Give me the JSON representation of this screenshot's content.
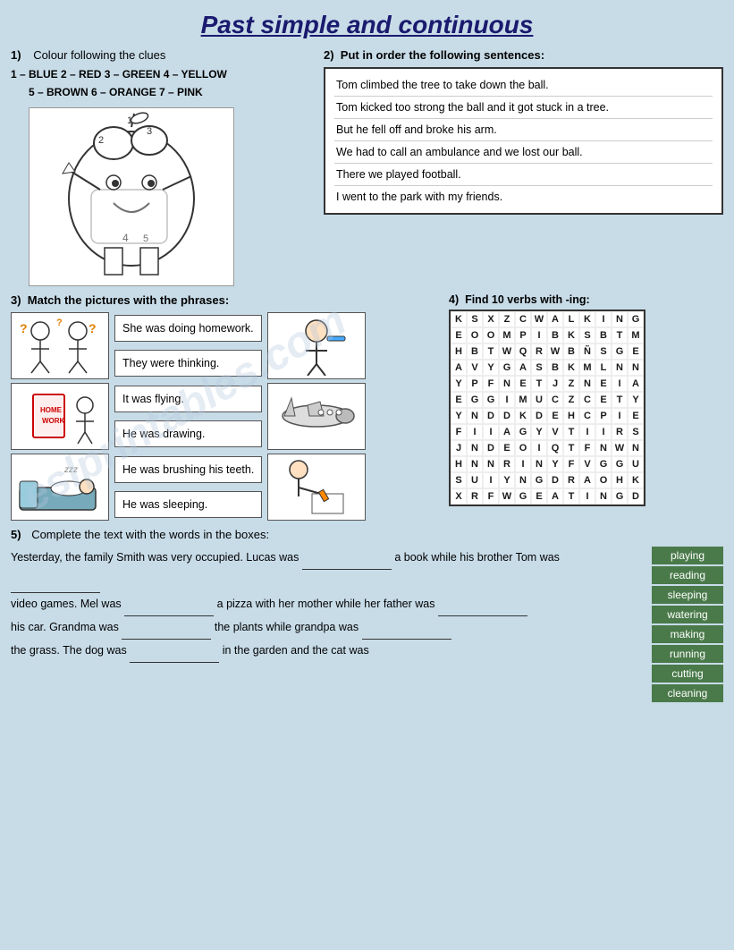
{
  "title": "Past simple and continuous",
  "section1": {
    "label": "1)",
    "instruction": "Colour following the clues",
    "clues_line1": "1 – BLUE   2 – RED   3 – GREEN   4 – YELLOW",
    "clues_line2": "5 – BROWN   6 – ORANGE   7 – PINK"
  },
  "section2": {
    "label": "2)",
    "instruction": "Put in order the following sentences:",
    "sentences": [
      "Tom climbed the tree to take down the ball.",
      "Tom kicked too strong the ball and it got stuck in a tree.",
      "But he fell off and broke his arm.",
      "We had to call an ambulance and we lost our ball.",
      "There we played football.",
      "I went to the park with my friends."
    ]
  },
  "section3": {
    "label": "3)",
    "instruction": "Match the pictures with the phrases:",
    "phrases": [
      "She was doing homework.",
      "They were thinking.",
      "It was flying.",
      "He was drawing.",
      "He was brushing his teeth.",
      "He was sleeping."
    ]
  },
  "section4": {
    "label": "4)",
    "instruction": "Find 10 verbs with -ing:",
    "grid": [
      [
        "K",
        "S",
        "X",
        "Z",
        "C",
        "W",
        "A",
        "L",
        "K",
        "I",
        "N",
        "G"
      ],
      [
        "E",
        "O",
        "O",
        "M",
        "P",
        "I",
        "B",
        "K",
        "S",
        "B",
        "T",
        "M"
      ],
      [
        "H",
        "B",
        "T",
        "W",
        "Q",
        "R",
        "W",
        "B",
        "Ñ",
        "S",
        "G",
        "E"
      ],
      [
        "A",
        "V",
        "Y",
        "G",
        "A",
        "S",
        "B",
        "K",
        "M",
        "L",
        "N",
        "N"
      ],
      [
        "Y",
        "P",
        "F",
        "N",
        "E",
        "T",
        "J",
        "Z",
        "N",
        "E",
        "I",
        "A"
      ],
      [
        "E",
        "G",
        "G",
        "I",
        "M",
        "U",
        "C",
        "Z",
        "C",
        "E",
        "T",
        "Y"
      ],
      [
        "Y",
        "N",
        "D",
        "D",
        "K",
        "D",
        "E",
        "H",
        "C",
        "P",
        "I",
        "E"
      ],
      [
        "F",
        "I",
        "I",
        "A",
        "G",
        "Y",
        "V",
        "T",
        "I",
        "I",
        "R",
        "S"
      ],
      [
        "J",
        "N",
        "D",
        "E",
        "O",
        "I",
        "Q",
        "T",
        "F",
        "N",
        "W",
        "N"
      ],
      [
        "H",
        "N",
        "N",
        "R",
        "I",
        "N",
        "Y",
        "F",
        "V",
        "G",
        "G",
        "U"
      ],
      [
        "S",
        "U",
        "I",
        "Y",
        "N",
        "G",
        "D",
        "R",
        "A",
        "O",
        "H",
        "K"
      ],
      [
        "X",
        "R",
        "F",
        "W",
        "G",
        "E",
        "A",
        "T",
        "I",
        "N",
        "G",
        "D"
      ]
    ]
  },
  "section5": {
    "label": "5)",
    "instruction": "Complete the text with the words in the boxes:",
    "text_parts": [
      "Yesterday, the family Smith was very occupied. Lucas was",
      "a book while his brother Tom was",
      "video games. Mel was",
      "a pizza with her mother while her father was",
      "his car. Grandma was",
      "the plants while grandpa was",
      "the grass. The dog was",
      "in the garden and the cat was"
    ],
    "word_boxes": [
      "playing",
      "reading",
      "sleeping",
      "watering",
      "making",
      "running",
      "cutting",
      "cleaning"
    ]
  },
  "watermark": "eslprintables.com"
}
